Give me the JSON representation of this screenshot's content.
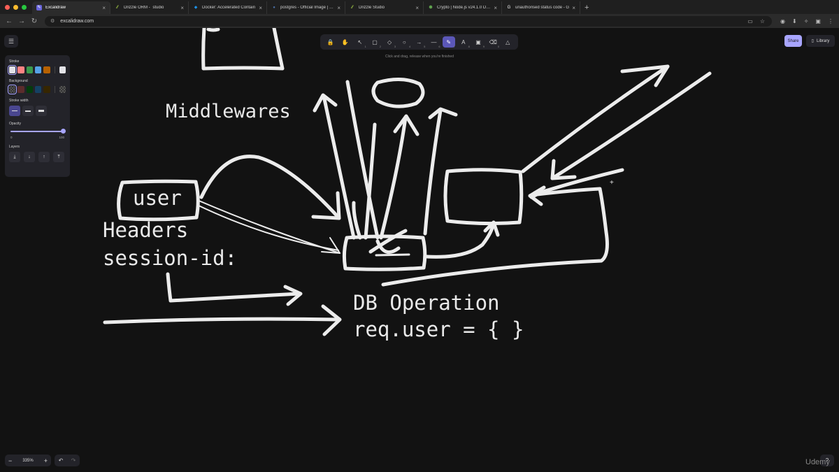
{
  "browser": {
    "tabs": [
      {
        "title": "Excalidraw",
        "active": true
      },
      {
        "title": "Drizzle ORM - `studio`",
        "active": false
      },
      {
        "title": "Docker: Accelerated Contain",
        "active": false
      },
      {
        "title": "postgres - Official Image | Do",
        "active": false
      },
      {
        "title": "Drizzle Studio",
        "active": false
      },
      {
        "title": "Crypto | Node.js v24.1.0 Docs",
        "active": false
      },
      {
        "title": "unauthorised status code - G",
        "active": false
      }
    ],
    "url": "excalidraw.com"
  },
  "toolbar": {
    "tools": [
      {
        "name": "lock",
        "icon": "🔒",
        "key": ""
      },
      {
        "name": "hand",
        "icon": "✋",
        "key": ""
      },
      {
        "name": "select",
        "icon": "↖",
        "key": "1"
      },
      {
        "name": "rectangle",
        "icon": "▢",
        "key": "2"
      },
      {
        "name": "diamond",
        "icon": "◇",
        "key": "3"
      },
      {
        "name": "ellipse",
        "icon": "○",
        "key": "4"
      },
      {
        "name": "arrow",
        "icon": "→",
        "key": "5"
      },
      {
        "name": "line",
        "icon": "—",
        "key": "6"
      },
      {
        "name": "draw",
        "icon": "✎",
        "key": "7",
        "selected": true
      },
      {
        "name": "text",
        "icon": "A",
        "key": "8"
      },
      {
        "name": "image",
        "icon": "▣",
        "key": "9"
      },
      {
        "name": "eraser",
        "icon": "⌫",
        "key": "0"
      },
      {
        "name": "more-tools",
        "icon": "△",
        "key": ""
      }
    ],
    "hint": "Click and drag, release when you're finished"
  },
  "header": {
    "share_label": "Share",
    "library_label": "Library"
  },
  "properties": {
    "stroke_label": "Stroke",
    "stroke_colors": [
      "#e3e3e8",
      "#ff8383",
      "#3a994c",
      "#56a2e8",
      "#b76100"
    ],
    "stroke_current": "#e3e3e8",
    "background_label": "Background",
    "background_colors": [
      "transparent",
      "#5b2c2c",
      "#043b0c",
      "#154163",
      "#362600"
    ],
    "stroke_width_label": "Stroke width",
    "opacity_label": "Opacity",
    "opacity_min": "0",
    "opacity_max": "100",
    "opacity_value": 100,
    "layers_label": "Layers",
    "layer_icons": [
      "⤓",
      "↓",
      "↑",
      "⤒"
    ]
  },
  "footer": {
    "zoom": "335%",
    "zoom_out": "−",
    "zoom_in": "+",
    "undo": "↶",
    "redo": "↷",
    "help": "?"
  },
  "canvas_text": {
    "middlewares": "Middlewares",
    "user": "user",
    "headers": "Headers",
    "session_id": "session-id:",
    "db_operation": "DB Operation",
    "req_user": "req.user = {  }"
  },
  "watermark": "Udemy"
}
